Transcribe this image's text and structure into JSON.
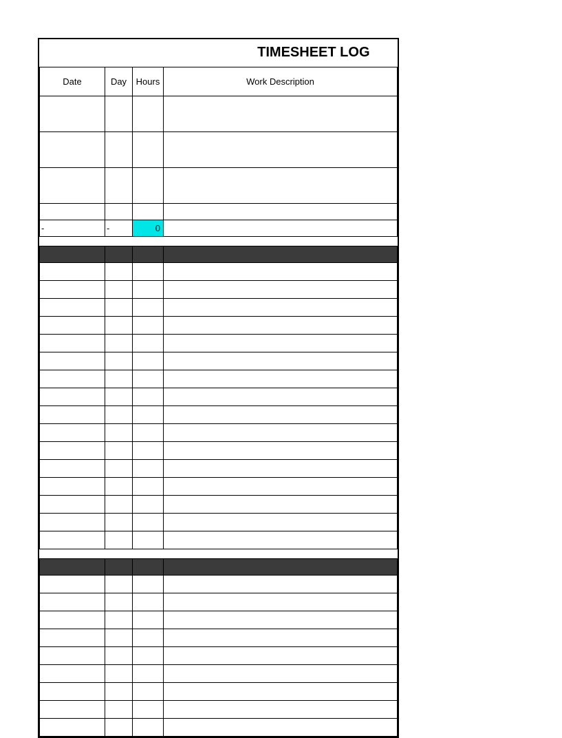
{
  "title": "TIMESHEET LOG",
  "headers": {
    "date": "Date",
    "day": "Day",
    "hours": "Hours",
    "desc": "Work Description"
  },
  "section1": {
    "rows": [
      {
        "date": "",
        "day": "",
        "hours": "",
        "desc": ""
      },
      {
        "date": "",
        "day": "",
        "hours": "",
        "desc": ""
      },
      {
        "date": "",
        "day": "",
        "hours": "",
        "desc": ""
      },
      {
        "date": "",
        "day": "",
        "hours": "",
        "desc": ""
      }
    ],
    "summary": {
      "date": "-",
      "day": "-",
      "hours": "0",
      "desc": ""
    }
  },
  "section2": {
    "rows": [
      {},
      {},
      {},
      {},
      {},
      {},
      {},
      {},
      {},
      {},
      {},
      {},
      {},
      {},
      {},
      {}
    ]
  },
  "section3": {
    "rows": [
      {},
      {},
      {},
      {},
      {},
      {},
      {},
      {},
      {}
    ]
  }
}
